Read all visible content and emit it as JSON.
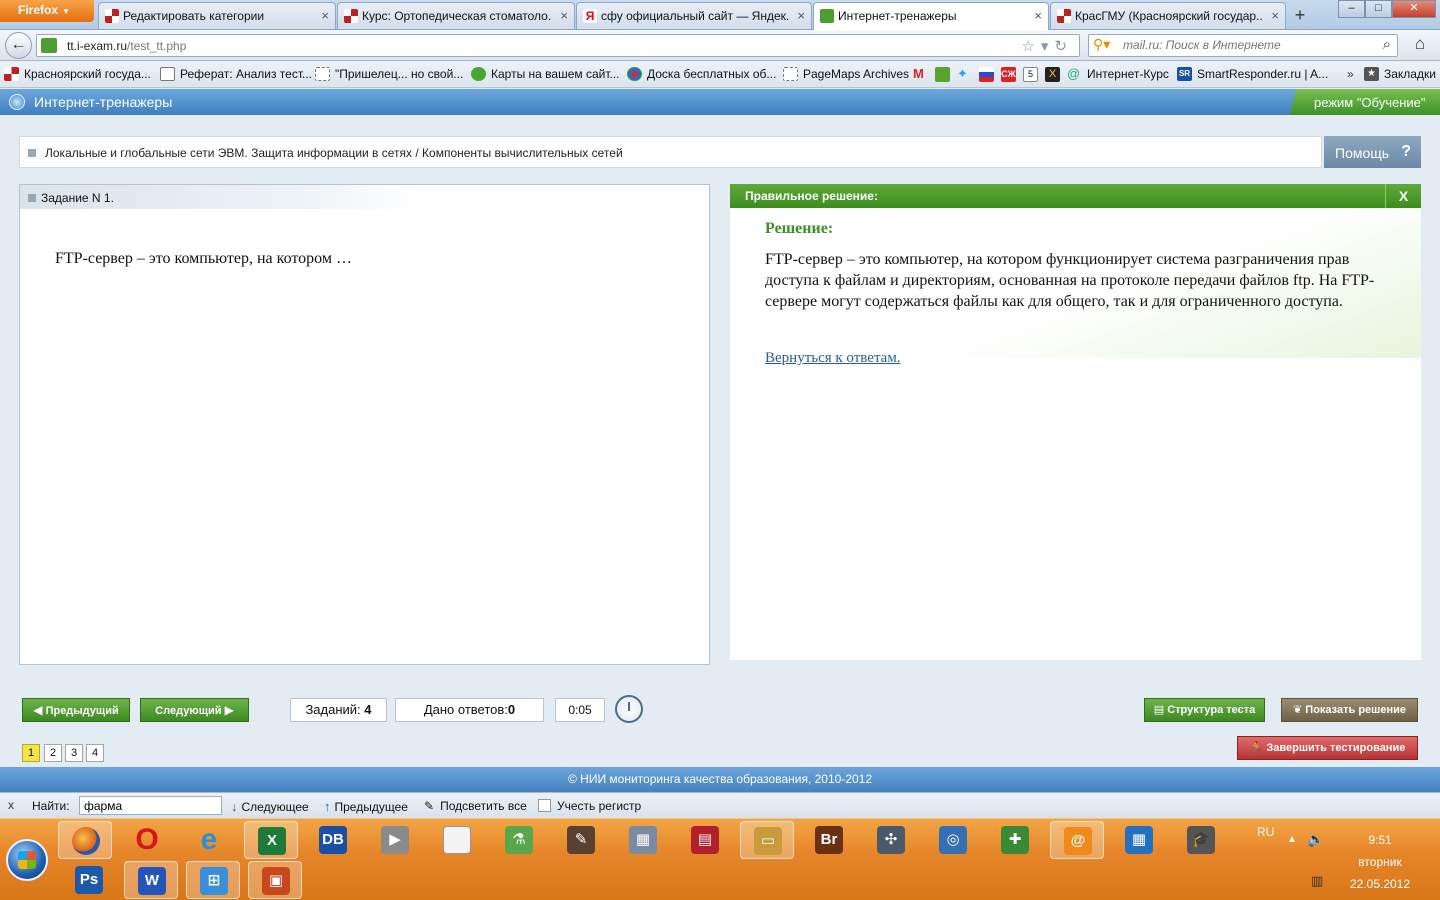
{
  "browser": {
    "menu_label": "Firefox",
    "tabs": [
      {
        "label": "Редактировать категории",
        "active": false
      },
      {
        "label": "Курс: Ортопедическая стоматоло...",
        "active": false
      },
      {
        "label": "сфу официальный сайт — Яндек...",
        "active": false
      },
      {
        "label": "Интернет-тренажеры",
        "active": true
      },
      {
        "label": "КрасГМУ (Красноярский государ...",
        "active": false
      }
    ],
    "url_host": "tt.i-exam.ru",
    "url_path": "/test_tt.php",
    "search_placeholder": "mail.ru: Поиск в Интернете",
    "bookmarks": [
      "Красноярский госуда...",
      "Реферат: Анализ тест...",
      "\"Пришелец... но свой...",
      "Карты на вашем сайт...",
      "Доска бесплатных об...",
      "PageMaps Archives",
      "Интернет-Курс",
      "SmartResponder.ru | A...",
      "Закладки"
    ]
  },
  "app": {
    "title": "Интернет-тренажеры",
    "mode": "режим \"Обучение\"",
    "breadcrumb": "Локальные и глобальные сети ЭВМ. Защита информации в сетях / Компоненты вычислительных сетей",
    "help_label": "Помощь",
    "help_symbol": "?",
    "question": {
      "header": "Задание N 1.",
      "text": "FTP-сервер – это компьютер, на котором …"
    },
    "solution": {
      "header": "Правильное решение:",
      "close_label": "X",
      "title": "Решение:",
      "body": "FTP-сервер – это компьютер, на котором функционирует система разграничения прав доступа к файлам и директориям, основанная на протоколе передачи файлов ftp.  На FTP-сервере могут содержаться файлы как для общего, так и для ограниченного доступа.",
      "back_link": "Вернуться к ответам."
    },
    "controls": {
      "prev_label": "Предыдущий",
      "next_label": "Следующий",
      "tasks_label": "Заданий:",
      "tasks_value": "4",
      "answers_label": "Дано ответов:",
      "answers_value": "0",
      "timer": "0:05",
      "structure_label": "Структура теста",
      "show_solution_label": "Показать решение",
      "finish_label": "Завершить тестирование",
      "pages": [
        "1",
        "2",
        "3",
        "4"
      ],
      "current_page": "1"
    },
    "footer": "© НИИ мониторинга качества образования, 2010-2012"
  },
  "findbar": {
    "close": "x",
    "label": "Найти:",
    "value": "фарма",
    "next_label": "Следующее",
    "prev_label": "Предыдущее",
    "highlight_label": "Подсветить все",
    "case_label": "Учесть регистр"
  },
  "taskbar": {
    "lang": "RU",
    "time": "9:51",
    "day": "вторник",
    "date": "22.05.2012",
    "apps": [
      {
        "name": "firefox",
        "glyph": "",
        "color": "#d9621b"
      },
      {
        "name": "opera",
        "glyph": "O",
        "color": "#d8141c"
      },
      {
        "name": "internet-explorer",
        "glyph": "e",
        "color": "#2a8fd8"
      },
      {
        "name": "excel",
        "glyph": "X",
        "color": "#1f7a3a"
      },
      {
        "name": "db",
        "glyph": "DB",
        "color": "#1a4fa6"
      },
      {
        "name": "media-player",
        "glyph": "▶",
        "color": "#8a8a8a"
      },
      {
        "name": "document",
        "glyph": "",
        "color": "#f4f4f4"
      },
      {
        "name": "flask",
        "glyph": "⚗",
        "color": "#5aa64a"
      },
      {
        "name": "quill",
        "glyph": "✎",
        "color": "#5a4032"
      },
      {
        "name": "calculator",
        "glyph": "▦",
        "color": "#7a8aa0"
      },
      {
        "name": "floppy",
        "glyph": "▤",
        "color": "#b4202a"
      },
      {
        "name": "explorer",
        "glyph": "▭",
        "color": "#c99b3a"
      },
      {
        "name": "bridge",
        "glyph": "Br",
        "color": "#6b2f14"
      },
      {
        "name": "network-tool",
        "glyph": "✣",
        "color": "#4b5a6b"
      },
      {
        "name": "globe",
        "glyph": "◎",
        "color": "#3470b3"
      },
      {
        "name": "shield",
        "glyph": "✚",
        "color": "#3a8a35"
      },
      {
        "name": "mail-agent",
        "glyph": "@",
        "color": "#f08a1c"
      },
      {
        "name": "grid-app",
        "glyph": "▦",
        "color": "#2470c0"
      },
      {
        "name": "graduation-cap",
        "glyph": "🎓",
        "color": "#555555"
      }
    ],
    "apps_row2": [
      {
        "name": "photoshop",
        "glyph": "Ps",
        "color": "#1a5aa8"
      },
      {
        "name": "word",
        "glyph": "W",
        "color": "#2456b8"
      },
      {
        "name": "windows-flag",
        "glyph": "⊞",
        "color": "#3b8ed8"
      },
      {
        "name": "powerpoint",
        "glyph": "▣",
        "color": "#c8481e"
      }
    ]
  },
  "colors": {
    "accent_blue": "#4382c2",
    "accent_green": "#3d8a22",
    "finish_red": "#b93434",
    "taskbar_orange": "#e6862a"
  }
}
